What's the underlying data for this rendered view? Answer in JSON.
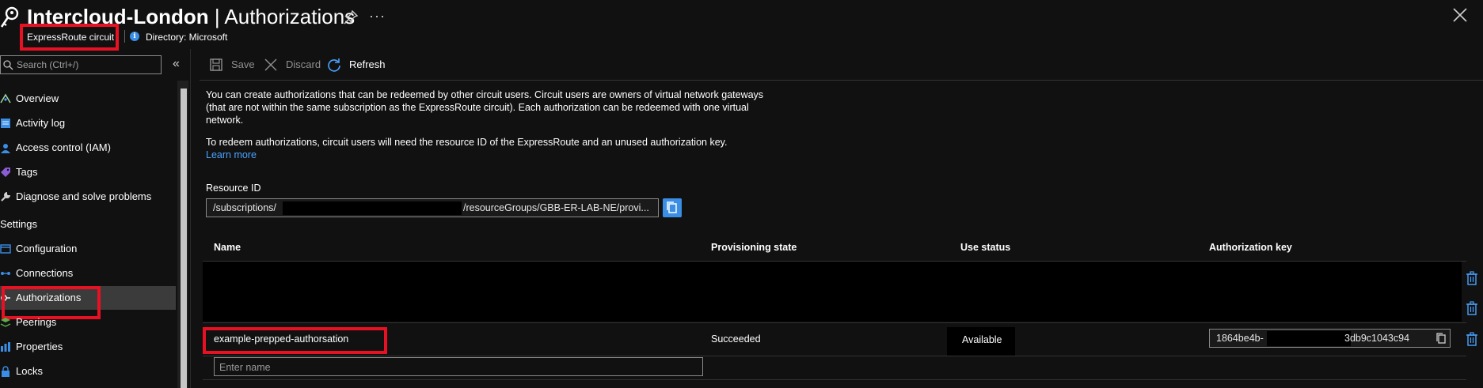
{
  "header": {
    "title_bold": "Intercloud-London",
    "title_rest": " | Authorizations",
    "subtitle": "ExpressRoute circuit",
    "directory": "Directory: Microsoft"
  },
  "sidebar": {
    "search_placeholder": "Search (Ctrl+/)",
    "collapse_glyph": "«",
    "items": [
      {
        "label": "Overview",
        "icon": "overview-icon"
      },
      {
        "label": "Activity log",
        "icon": "activity-log-icon"
      },
      {
        "label": "Access control (IAM)",
        "icon": "iam-icon"
      },
      {
        "label": "Tags",
        "icon": "tag-icon"
      },
      {
        "label": "Diagnose and solve problems",
        "icon": "wrench-icon"
      }
    ],
    "section_label": "Settings",
    "settings_items": [
      {
        "label": "Configuration",
        "icon": "configuration-icon"
      },
      {
        "label": "Connections",
        "icon": "connections-icon"
      },
      {
        "label": "Authorizations",
        "icon": "key-icon",
        "active": true
      },
      {
        "label": "Peerings",
        "icon": "peerings-icon"
      },
      {
        "label": "Properties",
        "icon": "properties-icon"
      },
      {
        "label": "Locks",
        "icon": "lock-icon"
      }
    ]
  },
  "toolbar": {
    "save_label": "Save",
    "discard_label": "Discard",
    "refresh_label": "Refresh"
  },
  "description": {
    "paragraph1": "You can create authorizations that can be redeemed by other circuit users. Circuit users are owners of virtual network gateways (that are not within the same subscription as the ExpressRoute circuit). Each authorization can be redeemed with one virtual network.",
    "paragraph2": "To redeem authorizations, circuit users will need the resource ID of the ExpressRoute and an unused authorization key.",
    "learn_more": "Learn more"
  },
  "resource_id": {
    "label": "Resource ID",
    "prefix": "/subscriptions/",
    "suffix": "/resourceGroups/GBB-ER-LAB-NE/provi..."
  },
  "table": {
    "headers": [
      "Name",
      "Provisioning state",
      "Use status",
      "Authorization key"
    ],
    "row": {
      "name": "example-prepped-authorsation",
      "provisioning_state": "Succeeded",
      "use_status": "Available",
      "key_start": "1864be4b-",
      "key_end": "3db9c1043c94"
    },
    "new_name_placeholder": "Enter name"
  },
  "colors": {
    "background": "#111111",
    "accent": "#3a8ee6",
    "highlight": "#e81123",
    "link": "#4aa3ff"
  }
}
